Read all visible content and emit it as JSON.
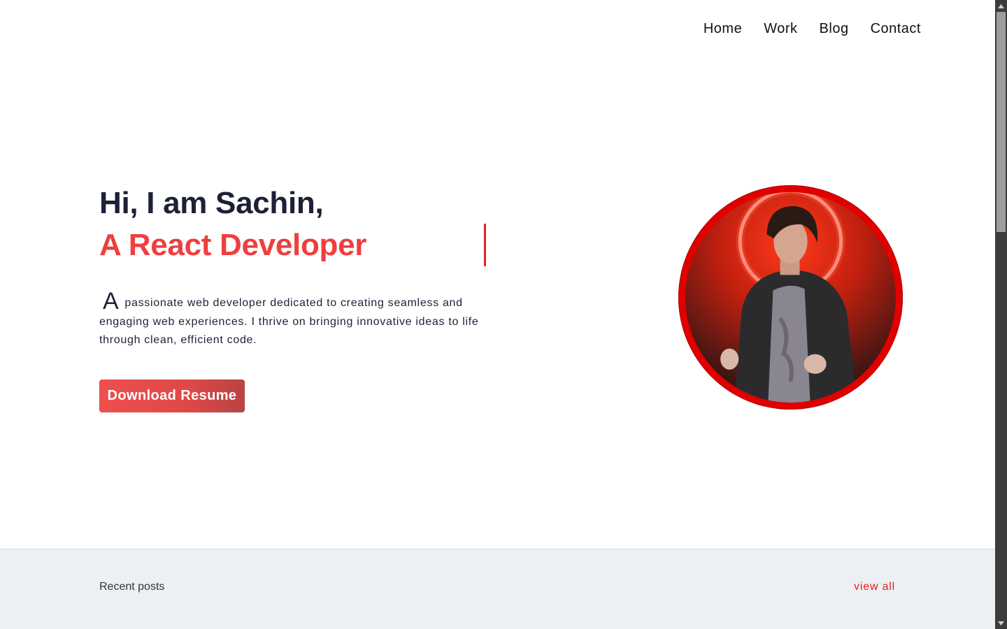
{
  "nav": {
    "items": [
      {
        "label": "Home"
      },
      {
        "label": "Work"
      },
      {
        "label": "Blog"
      },
      {
        "label": "Contact"
      }
    ]
  },
  "hero": {
    "greeting": "Hi, I am Sachin,",
    "role": "A React Developer",
    "description_dropcap": "A",
    "description_rest": "passionate web developer dedicated to creating seamless and engaging web experiences. I thrive on bringing innovative ideas to life through clean, efficient code.",
    "cta_label": "Download Resume"
  },
  "recent_posts": {
    "title": "Recent posts",
    "view_all_label": "view all"
  },
  "colors": {
    "accent": "#ef3e3e",
    "text_dark": "#1c2137",
    "posts_bg": "#edf0f2"
  },
  "icons": {
    "scroll_up": "triangle-up-icon",
    "scroll_down": "triangle-down-icon"
  }
}
